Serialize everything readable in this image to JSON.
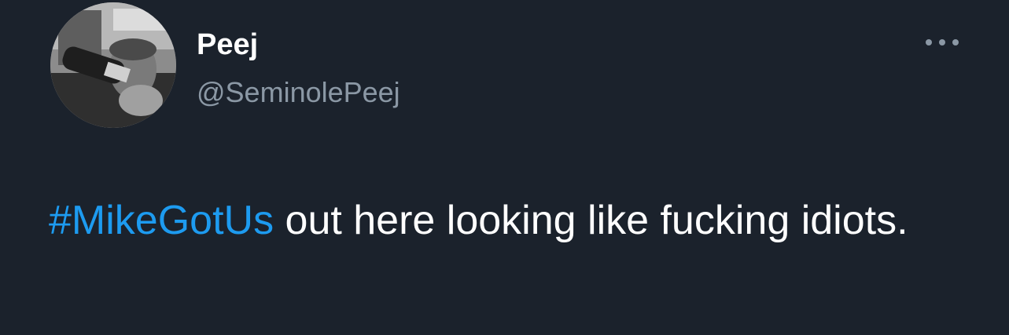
{
  "author": {
    "display_name": "Peej",
    "handle": "@SeminolePeej",
    "avatar_icon": "profile-photo"
  },
  "more_menu": {
    "icon": "more-horizontal-icon"
  },
  "tweet": {
    "hashtag": "#MikeGotUs",
    "text_after_hashtag": " out here looking like fucking idiots."
  },
  "colors": {
    "background": "#1b222c",
    "hashtag": "#1d9bf0",
    "handle": "#8b98a5",
    "text": "#ffffff"
  }
}
